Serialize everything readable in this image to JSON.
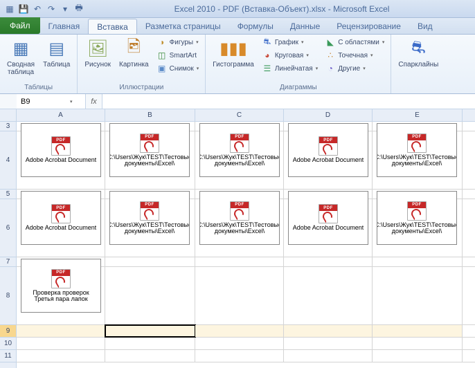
{
  "title": "Excel 2010 - PDF (Вставка-Объект).xlsx - Microsoft Excel",
  "tabs": {
    "file": "Файл",
    "items": [
      "Главная",
      "Вставка",
      "Разметка страницы",
      "Формулы",
      "Данные",
      "Рецензирование",
      "Вид"
    ],
    "active": 1
  },
  "ribbon": {
    "tables": {
      "label": "Таблицы",
      "pivot": "Сводная\nтаблица",
      "table": "Таблица"
    },
    "illus": {
      "label": "Иллюстрации",
      "picture": "Рисунок",
      "clipart": "Картинка",
      "shapes": "Фигуры",
      "smartart": "SmartArt",
      "screenshot": "Снимок"
    },
    "charts": {
      "label": "Диаграммы",
      "histogram": "Гистограмма",
      "line": "График",
      "pie": "Круговая",
      "bar": "Линейчатая",
      "area": "С областями",
      "scatter": "Точечная",
      "other": "Другие"
    },
    "spark": {
      "label": "",
      "sparklines": "Спарклайны"
    }
  },
  "namebox": "B9",
  "fx_label": "fx",
  "columns": [
    "A",
    "B",
    "C",
    "D",
    "E"
  ],
  "row_heights": {
    "3": 14,
    "4": 84,
    "5": 14,
    "6": 84,
    "7": 14,
    "8": 84,
    "9": 18,
    "10": 18,
    "11": 18
  },
  "active_cell": "B9",
  "pdf_badge": "PDF",
  "objects": [
    {
      "row": "4",
      "col": "A",
      "label": "Adobe Acrobat Document"
    },
    {
      "row": "4",
      "col": "B",
      "label": "C:\\Users\\Жук\\TEST\\Тестовые документы\\Excel\\"
    },
    {
      "row": "4",
      "col": "C",
      "label": "C:\\Users\\Жук\\TEST\\Тестовые документы\\Excel\\"
    },
    {
      "row": "4",
      "col": "D",
      "label": "Adobe Acrobat Document"
    },
    {
      "row": "4",
      "col": "E",
      "label": "C:\\Users\\Жук\\TEST\\Тестовые документы\\Excel\\"
    },
    {
      "row": "6",
      "col": "A",
      "label": "Adobe Acrobat Document"
    },
    {
      "row": "6",
      "col": "B",
      "label": "C:\\Users\\Жук\\TEST\\Тестовые документы\\Excel\\"
    },
    {
      "row": "6",
      "col": "C",
      "label": "C:\\Users\\Жук\\TEST\\Тестовые документы\\Excel\\"
    },
    {
      "row": "6",
      "col": "D",
      "label": "Adobe Acrobat Document"
    },
    {
      "row": "6",
      "col": "E",
      "label": "C:\\Users\\Жук\\TEST\\Тестовые документы\\Excel\\"
    },
    {
      "row": "8",
      "col": "A",
      "label": "Проверка проверок Третья пара лапок"
    }
  ]
}
